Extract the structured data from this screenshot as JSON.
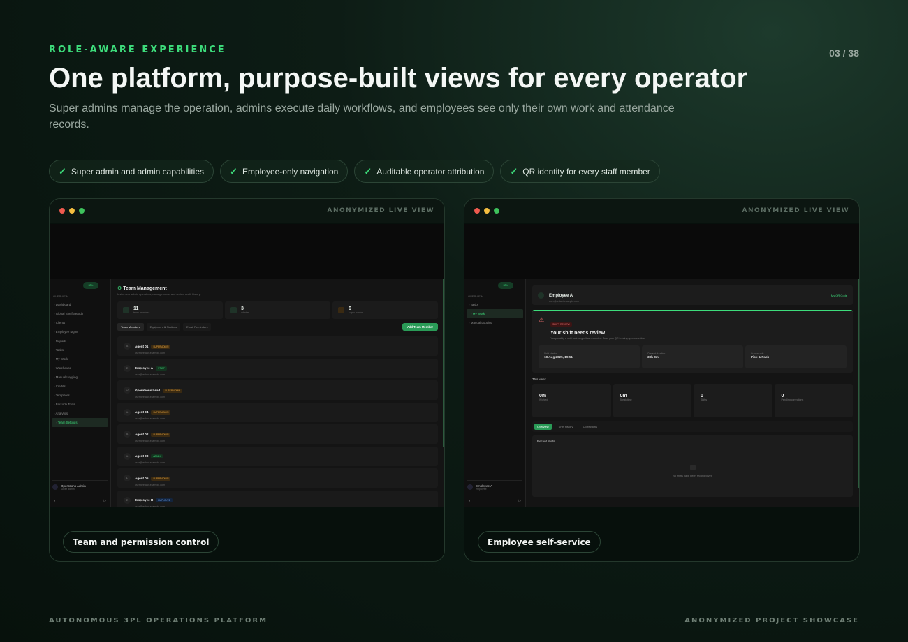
{
  "header": {
    "eyebrow": "ROLE-AWARE EXPERIENCE",
    "pager": "03 / 38",
    "title": "One platform, purpose-built views for every operator",
    "subtitle": "Super admins manage the operation, admins execute daily workflows, and employees see only their own work and attendance records."
  },
  "pills": [
    "Super admin and admin capabilities",
    "Employee-only navigation",
    "Auditable operator attribution",
    "QR identity for every staff member"
  ],
  "accent_color": "#3ddc7b",
  "cards": [
    {
      "label": "ANONYMIZED LIVE VIEW",
      "caption": "Team and permission control"
    },
    {
      "label": "ANONYMIZED LIVE VIEW",
      "caption": "Employee self-service"
    }
  ],
  "admin_view": {
    "logo": "3PL",
    "section": "OVERVIEW",
    "nav": [
      "Dashboard",
      "Global Shelf Search",
      "Clients",
      "Employee Mgmt",
      "Reports",
      "Tasks",
      "My Work",
      "Warehouse",
      "Manual Logging",
      "Credits",
      "Templates",
      "Barcode Tools",
      "Analytics",
      "Team Settings"
    ],
    "active_nav": "Team Settings",
    "user": {
      "name": "Operations Admin",
      "role": "super admin"
    },
    "title": "Team Management",
    "subtitle": "Invite new admin operators, manage roles, and review audit history.",
    "stats": [
      {
        "value": "11",
        "label": "team members"
      },
      {
        "value": "3",
        "label": "admins"
      },
      {
        "value": "6",
        "label": "super admins"
      }
    ],
    "tabs": [
      "Team Members",
      "Equipment & Stations",
      "Email Reminders"
    ],
    "add_button": "Add Team Member",
    "rows": [
      {
        "initial": "A",
        "name": "Agent 01",
        "badge": "SUPER ADMIN",
        "kind": "super",
        "email": "user@redact.example.com"
      },
      {
        "initial": "E",
        "name": "Employee A",
        "badge": "STAFF",
        "kind": "staff",
        "email": "user@redact.example.com"
      },
      {
        "initial": "O",
        "name": "Operations Lead",
        "badge": "SUPER ADMIN",
        "kind": "super",
        "email": "user@redact.example.com"
      },
      {
        "initial": "A",
        "name": "Agent 04",
        "badge": "SUPER ADMIN",
        "kind": "super",
        "email": "user@redact.example.com"
      },
      {
        "initial": "A",
        "name": "Agent 02",
        "badge": "SUPER ADMIN",
        "kind": "super",
        "email": "user@redact.example.com"
      },
      {
        "initial": "A",
        "name": "Agent 03",
        "badge": "ADMIN",
        "kind": "staff",
        "email": "user@redact.example.com"
      },
      {
        "initial": "L",
        "name": "Agent 05",
        "badge": "SUPER ADMIN",
        "kind": "super",
        "email": "user@redact.example.com"
      },
      {
        "initial": "E",
        "name": "Employee B",
        "badge": "EMPLOYEE",
        "kind": "blue",
        "email": "user@redact.example.com"
      }
    ]
  },
  "employee_view": {
    "logo": "3PL",
    "section": "OVERVIEW",
    "nav": [
      "Tasks",
      "My Work",
      "Manual Logging"
    ],
    "active_nav": "My Work",
    "user": {
      "name": "Employee A",
      "role": "employee"
    },
    "name": "Employee A",
    "sub": "user@redact.example.com",
    "qr": "My QR Code",
    "alert_badge": "SHIFT REVIEW",
    "alert_title": "Your shift needs review",
    "alert_sub": "You possibly a shift took longer than expected. Scan your QR to bring up a correction.",
    "mini": [
      {
        "label": "Shift started",
        "value": "18 Aug 2025, 19:51"
      },
      {
        "label": "Current duration",
        "value": "38h 8m"
      },
      {
        "label": "Current role",
        "value": "Pick & Pack"
      }
    ],
    "week_label": "This week",
    "week": [
      {
        "value": "0m",
        "label": "Worked"
      },
      {
        "value": "0m",
        "label": "Break time"
      },
      {
        "value": "0",
        "label": "Shifts"
      },
      {
        "value": "0",
        "label": "Pending corrections"
      }
    ],
    "tabs": [
      "Overview",
      "Shift history",
      "Corrections"
    ],
    "recent_title": "Recent shifts",
    "empty": "No shifts have been recorded yet."
  },
  "footer": {
    "left": "AUTONOMOUS 3PL OPERATIONS PLATFORM",
    "right": "ANONYMIZED PROJECT SHOWCASE"
  }
}
